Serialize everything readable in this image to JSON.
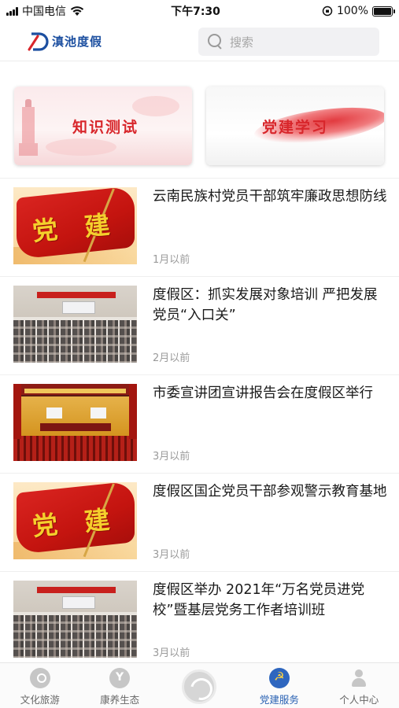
{
  "status_bar": {
    "carrier": "中国电信",
    "time": "下午7:30",
    "battery_text": "100%",
    "battery_level": 1.0
  },
  "header": {
    "logo_text": "滇池度假",
    "search_placeholder": "搜索"
  },
  "quick_cards": [
    {
      "label": "知识测试"
    },
    {
      "label": "党建学习"
    }
  ],
  "news": [
    {
      "title": "云南民族村党员干部筑牢廉政思想防线",
      "time": "1月以前",
      "thumb_text_left": "党",
      "thumb_text_right": "建"
    },
    {
      "title": "度假区：抓实发展对象培训  严把发展党员“入口关”",
      "time": "2月以前"
    },
    {
      "title": "市委宣讲团宣讲报告会在度假区举行",
      "time": "3月以前"
    },
    {
      "title": "度假区国企党员干部参观警示教育基地",
      "time": "3月以前",
      "thumb_text_left": "党",
      "thumb_text_right": "建"
    },
    {
      "title": "度假区举办 2021年“万名党员进党校”暨基层党务工作者培训班",
      "time": "3月以前"
    }
  ],
  "tabbar": {
    "tabs": [
      {
        "label": "文化旅游",
        "icon": "location-icon"
      },
      {
        "label": "康养生态",
        "icon": "leaf-icon"
      },
      {
        "label": "",
        "icon": "home-logo-icon"
      },
      {
        "label": "党建服务",
        "icon": "party-emblem-icon",
        "active": true
      },
      {
        "label": "个人中心",
        "icon": "user-icon"
      }
    ]
  },
  "colors": {
    "accent_blue": "#2a62b3",
    "party_red": "#d8262b",
    "muted_text": "#9a9a9a"
  }
}
